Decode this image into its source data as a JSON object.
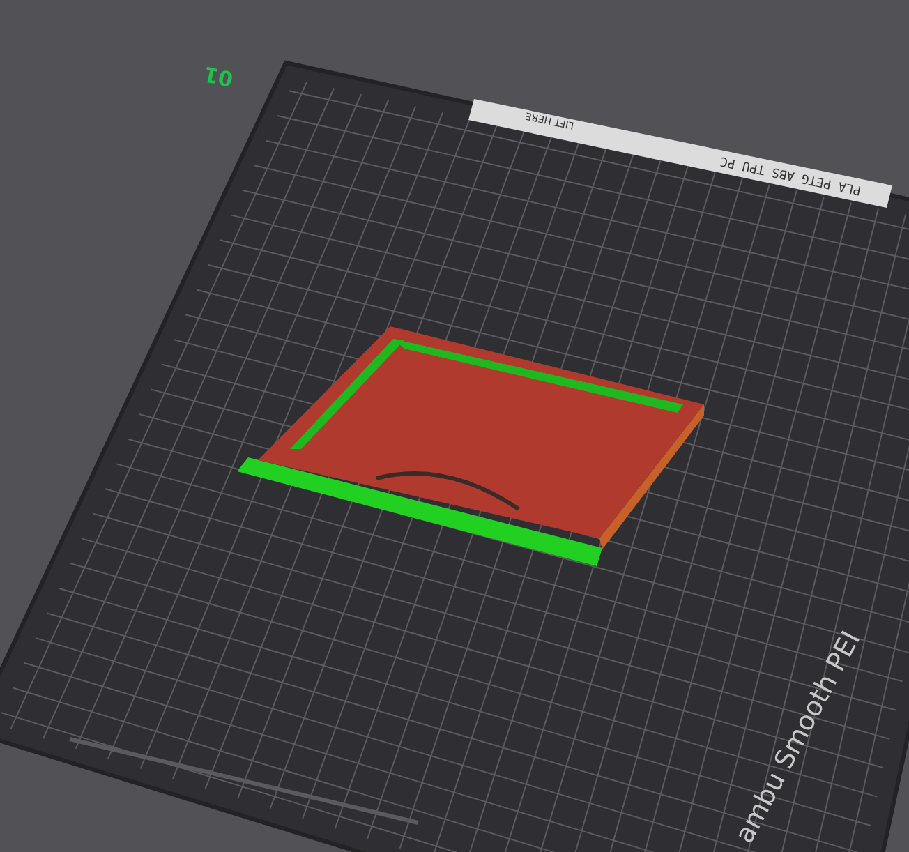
{
  "viewport": {
    "plate": {
      "number": "01",
      "filament_strip": "PLA PETG ABS TPU PC",
      "strip_note": "LIFT HERE",
      "surface_name": "ambu Smooth PEI"
    }
  }
}
